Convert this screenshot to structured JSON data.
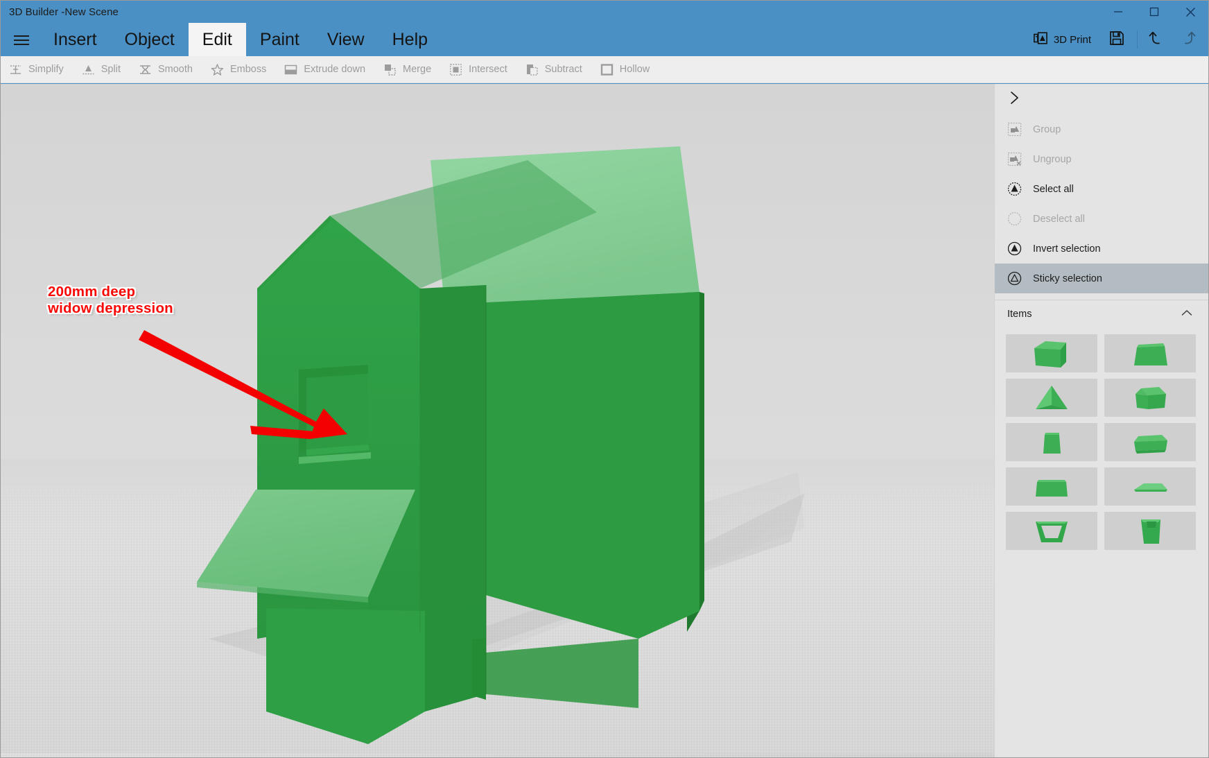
{
  "window": {
    "title": "3D Builder  -New Scene",
    "controls": [
      {
        "name": "minimize",
        "glyph": "minimize-icon"
      },
      {
        "name": "maximize",
        "glyph": "maximize-icon"
      },
      {
        "name": "close",
        "glyph": "close-icon"
      }
    ]
  },
  "ribbon": {
    "menu_icon": "hamburger-icon",
    "tabs": [
      {
        "label": "Insert",
        "active": false
      },
      {
        "label": "Object",
        "active": false
      },
      {
        "label": "Edit",
        "active": true
      },
      {
        "label": "Paint",
        "active": false
      },
      {
        "label": "View",
        "active": false
      },
      {
        "label": "Help",
        "active": false
      }
    ],
    "print_label": "3D Print",
    "print_icon": "3d-print-icon",
    "save_icon": "save-floppy-icon",
    "undo_icon": "undo-arrow-icon",
    "redo_icon": "redo-arrow-icon"
  },
  "command_bar": {
    "commands": [
      {
        "label": "Simplify",
        "icon": "simplify-icon",
        "enabled": false
      },
      {
        "label": "Split",
        "icon": "split-icon",
        "enabled": false
      },
      {
        "label": "Smooth",
        "icon": "smooth-icon",
        "enabled": false
      },
      {
        "label": "Emboss",
        "icon": "emboss-star-icon",
        "enabled": false
      },
      {
        "label": "Extrude down",
        "icon": "extrude-down-icon",
        "enabled": false
      },
      {
        "label": "Merge",
        "icon": "merge-icon",
        "enabled": false
      },
      {
        "label": "Intersect",
        "icon": "intersect-icon",
        "enabled": false
      },
      {
        "label": "Subtract",
        "icon": "subtract-icon",
        "enabled": false
      },
      {
        "label": "Hollow",
        "icon": "hollow-icon",
        "enabled": false
      }
    ]
  },
  "sidebar": {
    "expand_icon": "chevron-right-icon",
    "actions": [
      {
        "label": "Group",
        "icon": "group-icon",
        "state": "disabled"
      },
      {
        "label": "Ungroup",
        "icon": "ungroup-icon",
        "state": "disabled"
      },
      {
        "label": "Select all",
        "icon": "select-all-icon",
        "state": "enabled"
      },
      {
        "label": "Deselect all",
        "icon": "deselect-all-icon",
        "state": "disabled"
      },
      {
        "label": "Invert selection",
        "icon": "invert-selection-icon",
        "state": "enabled"
      },
      {
        "label": "Sticky selection",
        "icon": "sticky-selection-icon",
        "state": "selected"
      }
    ],
    "items_panel": {
      "title": "Items",
      "collapse_icon": "chevron-up-icon",
      "thumbnails": [
        {
          "name": "house-shape-thumb"
        },
        {
          "name": "trapezoid-shape-thumb"
        },
        {
          "name": "pyramid-shape-thumb"
        },
        {
          "name": "wedge-shape-thumb"
        },
        {
          "name": "slab-shape-thumb"
        },
        {
          "name": "flat-box-thumb"
        },
        {
          "name": "wide-block-thumb"
        },
        {
          "name": "thin-plate-thumb"
        },
        {
          "name": "open-frame-thumb"
        },
        {
          "name": "bucket-shape-thumb"
        }
      ]
    }
  },
  "viewport": {
    "annotation": {
      "line1": "200mm deep",
      "line2": "widow depression",
      "color": "#fa0806",
      "arrow_color": "#f50000"
    },
    "model": {
      "name": "green-house-model",
      "roof_color": "#86cd96",
      "wall_color": "#2d9e44",
      "wall_shadow_color": "#26883a",
      "awning_color": "#6ec27f"
    },
    "background_color": "#d8d8d8"
  }
}
